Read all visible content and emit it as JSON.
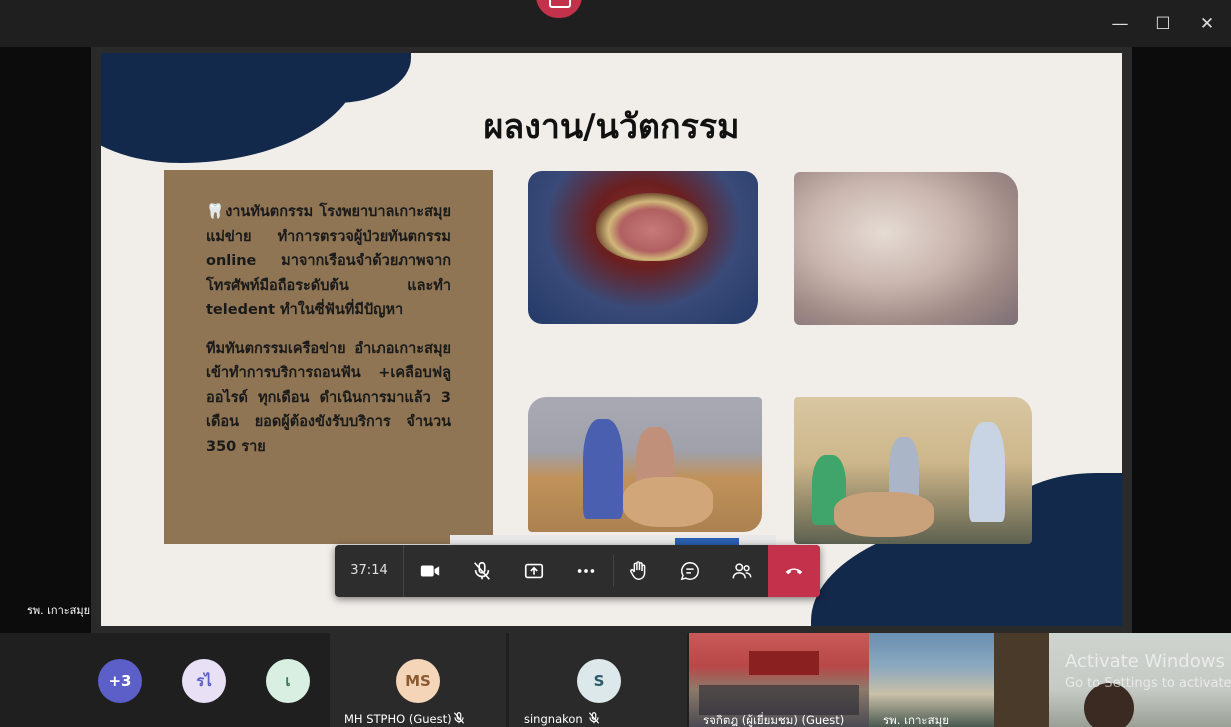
{
  "slide": {
    "title": "ผลงาน/นวัตกรรม",
    "paragraph1": "🦷งานทันตกรรม โรงพยาบาลเกาะสมุยแม่ข่าย ทำการตรวจผู้ป่วยทันตกรรม online มาจากเรือนจำด้วยภาพจากโทรศัพท์มือถือระดับต้น และทำ teledent ทำในซี่ฟันที่มีปัญหา",
    "paragraph2": "ทีมทันตกรรมเครือข่าย อำเภอเกาะสมุย เข้าทำการบริการถอนฟัน +เคลือบฟลูออไรด์ ทุกเดือน ดำเนินการมาแล้ว 3 เดือน ยอดผู้ต้องขังรับบริการ จำนวน 350 ราย"
  },
  "controls": {
    "timer": "37:14"
  },
  "self_label": "รพ. เกาะสมุย",
  "participants": {
    "overflow": "+3",
    "avatar1": "รไ",
    "avatar2": "เ",
    "tile1": {
      "initials": "MS",
      "name": "MH STPHO (Guest)"
    },
    "tile2": {
      "initials": "S",
      "name": "singnakon"
    },
    "video1_name": "รจกิตฎ (ผู้เยี่ยมชม) (Guest)",
    "video2_name": "รพ. เกาะสมุย"
  },
  "watermark": {
    "title": "Activate Windows",
    "subtitle": "Go to Settings to activate"
  },
  "colors": {
    "hangup": "#c4314b",
    "overflow_avatar": "#5b5fc7",
    "ms_avatar": "#f5d5b8",
    "s_avatar": "#dde8ea"
  }
}
